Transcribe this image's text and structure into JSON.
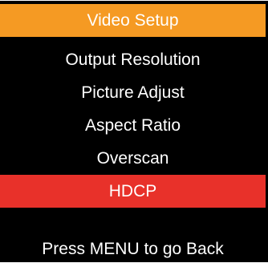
{
  "menu": {
    "title": "Video Setup",
    "items": [
      {
        "label": "Output Resolution",
        "selected": false
      },
      {
        "label": "Picture Adjust",
        "selected": false
      },
      {
        "label": "Aspect Ratio",
        "selected": false
      },
      {
        "label": "Overscan",
        "selected": false
      },
      {
        "label": "HDCP",
        "selected": true
      }
    ],
    "footer": "Press MENU to go Back"
  },
  "colors": {
    "title_bar": "#f59a23",
    "selected_item": "#e8312a",
    "background": "#000000",
    "text": "#ffffff"
  }
}
